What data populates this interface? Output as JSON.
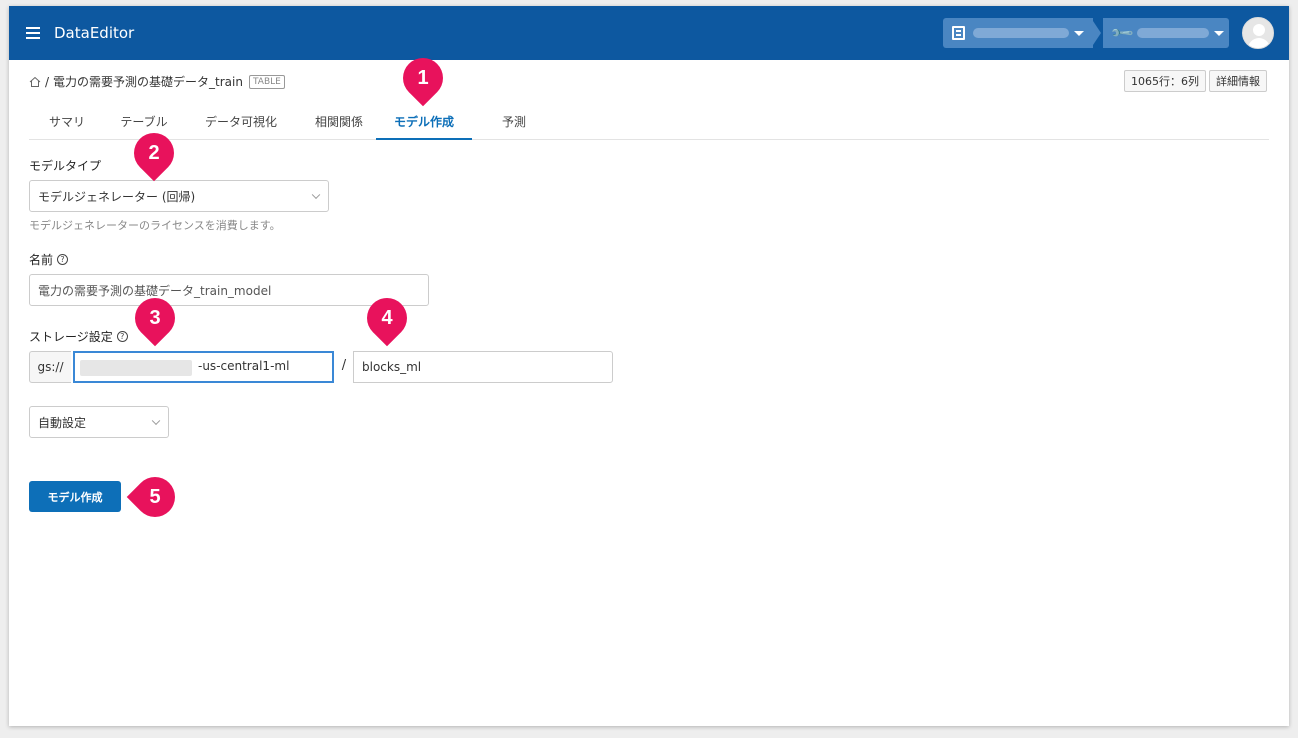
{
  "header": {
    "title": "DataEditor",
    "project_placeholder": "",
    "tool_placeholder": ""
  },
  "breadcrumb": {
    "separator": "/",
    "dataset": "電力の需要予測の基礎データ_train",
    "badge": "TABLE"
  },
  "meta": {
    "rows_cols": "1065行：6列",
    "details": "詳細情報"
  },
  "tabs": [
    {
      "label": "サマリ"
    },
    {
      "label": "テーブル"
    },
    {
      "label": "データ可視化"
    },
    {
      "label": "相関関係"
    },
    {
      "label": "モデル作成",
      "active": true
    },
    {
      "label": "予測"
    }
  ],
  "form": {
    "model_type_label": "モデルタイプ",
    "model_type_value": "モデルジェネレーター (回帰)",
    "model_type_hint": "モデルジェネレーターのライセンスを消費します。",
    "name_label": "名前",
    "name_value": "電力の需要予測の基礎データ_train_model",
    "storage_label": "ストレージ設定",
    "storage_prefix": "gs://",
    "bucket_suffix": "-us-central1-ml",
    "path_separator": "/",
    "folder_value": "blocks_ml",
    "auto_setting": "自動設定",
    "help_glyph": "?",
    "submit_label": "モデル作成"
  },
  "markers": [
    "1",
    "2",
    "3",
    "4",
    "5"
  ],
  "colors": {
    "header_bg": "#0d58a0",
    "accent": "#0d6fb8",
    "marker": "#e8125c"
  }
}
